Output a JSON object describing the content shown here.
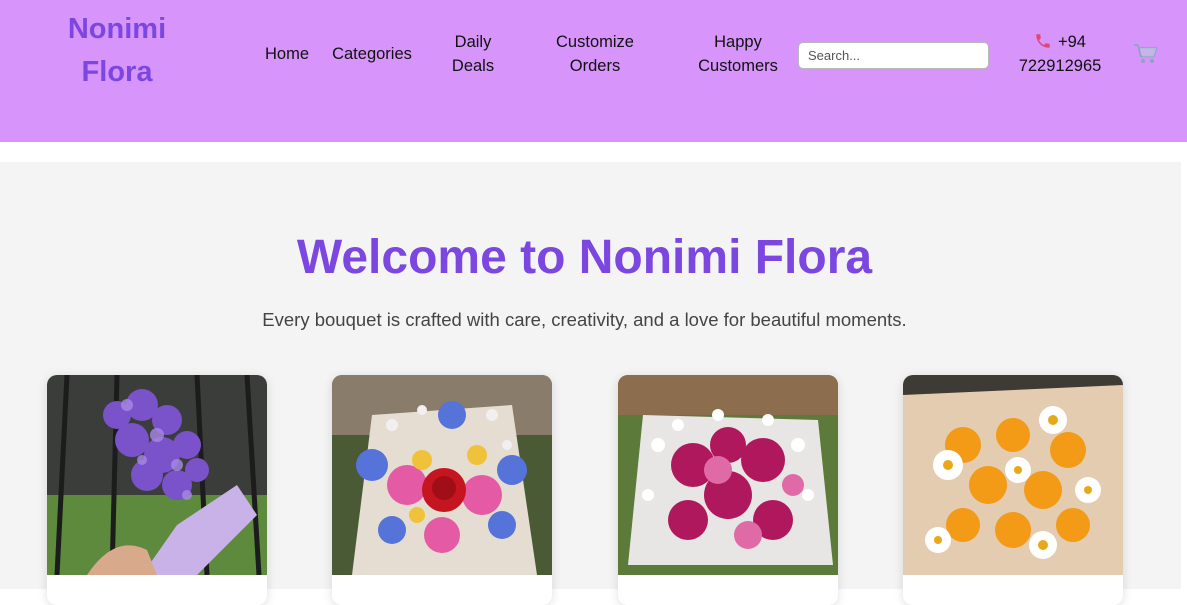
{
  "brand": {
    "name_line1": "Nonimi",
    "name_line2": "Flora"
  },
  "nav": {
    "home": "Home",
    "categories": "Categories",
    "daily_deals_1": "Daily",
    "daily_deals_2": "Deals",
    "customize_1": "Customize",
    "customize_2": "Orders",
    "happy_1": "Happy",
    "happy_2": "Customers"
  },
  "search": {
    "placeholder": "Search..."
  },
  "contact": {
    "phone_line1": "+94",
    "phone_line2": "722912965",
    "icon": "phone-icon"
  },
  "cart": {
    "icon": "cart-icon"
  },
  "hero": {
    "title": "Welcome to Nonimi Flora",
    "subtitle": "Every bouquet is crafted with care, creativity, and a love for beautiful moments."
  },
  "products": [
    {
      "image": "purple statice bouquet photo"
    },
    {
      "image": "mixed bouquet with red rose photo"
    },
    {
      "image": "magenta chrysanthemum bouquet photo"
    },
    {
      "image": "yellow and white daisy bouquet photo"
    }
  ],
  "colors": {
    "header_bg": "#d795fb",
    "brand_purple": "#7b47e0",
    "hero_bg": "#f4f4f4"
  }
}
